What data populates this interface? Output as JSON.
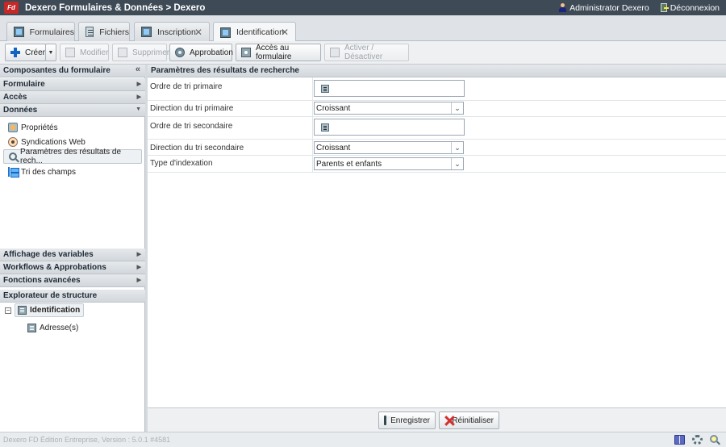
{
  "app": {
    "logo": "Fd",
    "title": "Dexero Formulaires & Données > Dexero"
  },
  "user": {
    "name": "Administrator Dexero",
    "logout": "Déconnexion"
  },
  "tabs": [
    {
      "label": "Formulaires",
      "icon": "form-icon"
    },
    {
      "label": "Fichiers",
      "icon": "file-icon"
    },
    {
      "label": "Inscription",
      "icon": "form-icon",
      "closable": true
    },
    {
      "label": "Identification",
      "icon": "form-icon",
      "closable": true,
      "active": true
    }
  ],
  "toolbar": {
    "create": "Créer",
    "edit": "Modifier",
    "delete": "Supprimer",
    "approval": "Approbation",
    "form_access": "Accès au formulaire",
    "toggle": "Activer / Désactiver"
  },
  "sidebar": {
    "components_title": "Composantes du formulaire",
    "sections": [
      "Formulaire",
      "Accès",
      "Données"
    ],
    "data_items": [
      {
        "label": "Propriétés",
        "icon": "properties-icon"
      },
      {
        "label": "Syndications Web",
        "icon": "rss-icon"
      },
      {
        "label": "Paramètres des résultats de rech...",
        "icon": "search-params-icon",
        "selected": true
      },
      {
        "label": "Tri des champs",
        "icon": "sort-fields-icon"
      }
    ],
    "bottom_sections": [
      "Affichage des variables",
      "Workflows & Approbations",
      "Fonctions avancées"
    ],
    "explorer_title": "Explorateur de structure",
    "tree": {
      "root": "Identification",
      "child": "Adresse(s)"
    }
  },
  "main": {
    "title": "Paramètres des résultats de recherche",
    "fields": [
      {
        "label": "Ordre de tri primaire",
        "type": "field-picker",
        "value": ""
      },
      {
        "label": "Direction du tri primaire",
        "type": "select",
        "value": "Croissant"
      },
      {
        "label": "Ordre de tri secondaire",
        "type": "field-picker",
        "value": ""
      },
      {
        "label": "Direction du tri secondaire",
        "type": "select",
        "value": "Croissant"
      },
      {
        "label": "Type d'indexation",
        "type": "select",
        "value": "Parents et enfants"
      }
    ],
    "save": "Enregistrer",
    "reset": "Réinitialiser"
  },
  "status": {
    "version": "Dexero FD Édition Entreprise, Version : 5.0.1 #4581"
  },
  "colors": {
    "titlebar": "#3e4a56",
    "accent": "#1565c0",
    "danger": "#d32f2f"
  }
}
